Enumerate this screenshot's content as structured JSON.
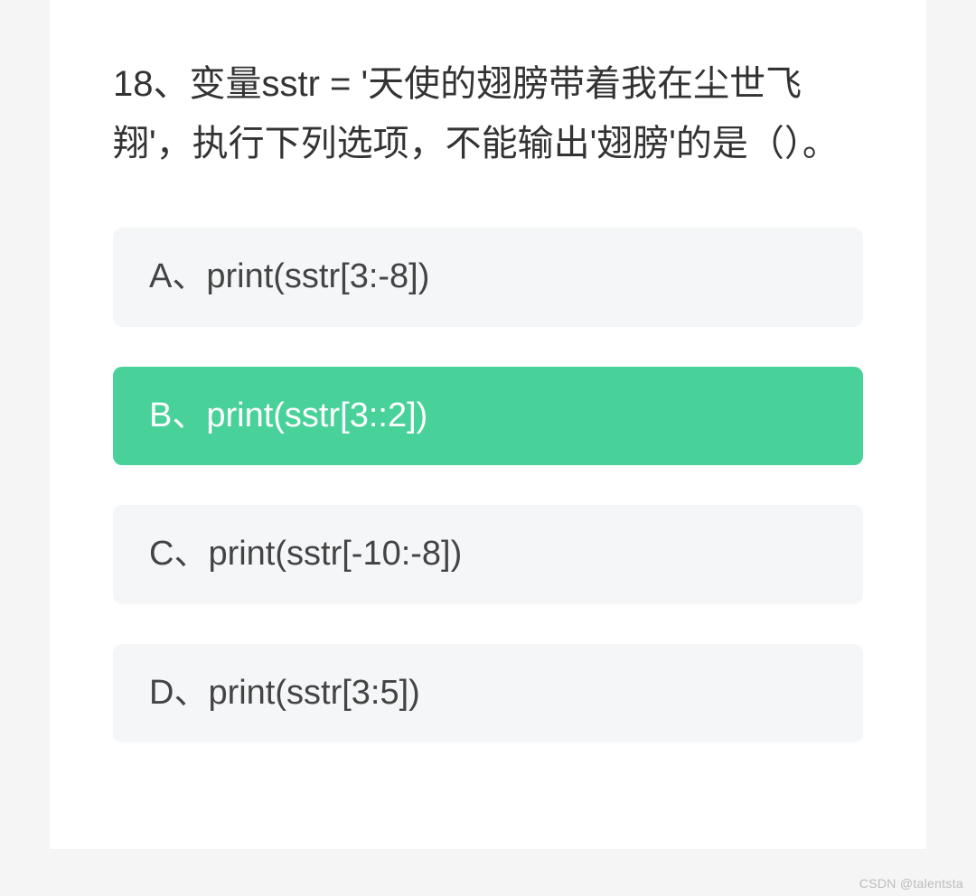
{
  "question": {
    "text": "18、变量sstr = '天使的翅膀带着我在尘世飞翔'，执行下列选项，不能输出'翅膀'的是（）。"
  },
  "options": [
    {
      "label": "A、print(sstr[3:-8])",
      "selected": false
    },
    {
      "label": "B、print(sstr[3::2])",
      "selected": true
    },
    {
      "label": "C、print(sstr[-10:-8])",
      "selected": false
    },
    {
      "label": "D、print(sstr[3:5])",
      "selected": false
    }
  ],
  "watermark": "CSDN @talentsta"
}
